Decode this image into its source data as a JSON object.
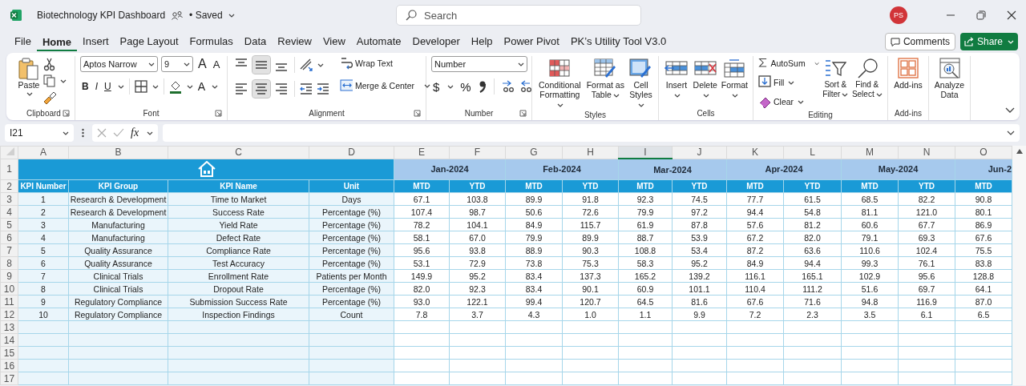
{
  "title_bar": {
    "file_name": "Biotechnology KPI Dashboard",
    "save_status": "• Saved",
    "search_placeholder": "Search",
    "avatar_initials": "PS"
  },
  "menu_tabs": [
    {
      "label": "File",
      "selected": false
    },
    {
      "label": "Home",
      "selected": true
    },
    {
      "label": "Insert",
      "selected": false
    },
    {
      "label": "Page Layout",
      "selected": false
    },
    {
      "label": "Formulas",
      "selected": false
    },
    {
      "label": "Data",
      "selected": false
    },
    {
      "label": "Review",
      "selected": false
    },
    {
      "label": "View",
      "selected": false
    },
    {
      "label": "Automate",
      "selected": false
    },
    {
      "label": "Developer",
      "selected": false
    },
    {
      "label": "Help",
      "selected": false
    },
    {
      "label": "Power Pivot",
      "selected": false
    },
    {
      "label": "PK’s Utility Tool V3.0",
      "selected": false
    }
  ],
  "header_buttons": {
    "comments": "Comments",
    "share": "Share"
  },
  "ribbon": {
    "clipboard": {
      "label": "Clipboard",
      "paste": "Paste"
    },
    "font": {
      "label": "Font",
      "font_name": "Aptos Narrow",
      "font_size": "9",
      "grow_font": "A",
      "shrink_font": "A",
      "bold": "B",
      "italic": "I",
      "underline": "U",
      "font_color": "A"
    },
    "alignment": {
      "label": "Alignment",
      "wrap_text": "Wrap Text",
      "merge_center": "Merge & Center",
      "vertical_buttons": [
        {
          "selected": false
        },
        {
          "selected": true
        },
        {
          "selected": false
        }
      ],
      "horizontal_buttons": [
        {
          "selected": false
        },
        {
          "selected": true
        },
        {
          "selected": false
        }
      ]
    },
    "number": {
      "label": "Number",
      "format": "Number",
      "currency": "$",
      "percent": "%"
    },
    "styles": {
      "label": "Styles",
      "conditional_formatting": "Conditional Formatting",
      "format_as_table": "Format as Table",
      "cell_styles": "Cell Styles"
    },
    "cells": {
      "label": "Cells",
      "insert": "Insert",
      "delete": "Delete",
      "format": "Format"
    },
    "editing": {
      "label": "Editing",
      "autosum": "AutoSum",
      "fill": "Fill",
      "clear": "Clear",
      "sort_filter": "Sort & Filter",
      "find_select": "Find & Select"
    },
    "add_ins": {
      "label": "Add-ins",
      "add_ins": "Add-ins"
    },
    "analysis": {
      "analyze_data": "Analyze Data"
    }
  },
  "formula_bar": {
    "name_box": "I21",
    "function_label": "fx"
  },
  "sheet": {
    "column_letters": [
      {
        "letter": "A",
        "selected": false
      },
      {
        "letter": "B",
        "selected": false
      },
      {
        "letter": "C",
        "selected": false
      },
      {
        "letter": "D",
        "selected": false
      },
      {
        "letter": "E",
        "selected": false
      },
      {
        "letter": "F",
        "selected": false
      },
      {
        "letter": "G",
        "selected": false
      },
      {
        "letter": "H",
        "selected": false
      },
      {
        "letter": "I",
        "selected": true
      },
      {
        "letter": "J",
        "selected": false
      },
      {
        "letter": "K",
        "selected": false
      },
      {
        "letter": "L",
        "selected": false
      },
      {
        "letter": "M",
        "selected": false
      },
      {
        "letter": "N",
        "selected": false
      },
      {
        "letter": "O",
        "selected": false
      }
    ],
    "row_numbers": [
      "1",
      "2",
      "3",
      "4",
      "5",
      "6",
      "7",
      "8",
      "9",
      "10",
      "11",
      "12",
      "13",
      "14",
      "15",
      "16",
      "17"
    ],
    "header_labels": [
      "KPI Number",
      "KPI Group",
      "KPI Name",
      "Unit"
    ],
    "months": [
      "Jan-2024",
      "Feb-2024",
      "Mar-2024",
      "Apr-2024",
      "May-2024",
      "Jun-2"
    ],
    "sub_headers": [
      "MTD",
      "YTD",
      "MTD",
      "YTD",
      "MTD",
      "YTD",
      "MTD",
      "YTD",
      "MTD",
      "YTD",
      "MTD"
    ],
    "rows": [
      {
        "number": "1",
        "group": "Research & Development",
        "name": "Time to Market",
        "unit": "Days",
        "values": [
          "67.1",
          "103.8",
          "89.9",
          "91.8",
          "92.3",
          "74.5",
          "77.7",
          "61.5",
          "68.5",
          "82.2",
          "90.8"
        ]
      },
      {
        "number": "2",
        "group": "Research & Development",
        "name": "Success Rate",
        "unit": "Percentage (%)",
        "values": [
          "107.4",
          "98.7",
          "50.6",
          "72.6",
          "79.9",
          "97.2",
          "94.4",
          "54.8",
          "81.1",
          "121.0",
          "80.1"
        ]
      },
      {
        "number": "3",
        "group": "Manufacturing",
        "name": "Yield Rate",
        "unit": "Percentage (%)",
        "values": [
          "78.2",
          "104.1",
          "84.9",
          "115.7",
          "61.9",
          "87.8",
          "57.6",
          "81.2",
          "60.6",
          "67.7",
          "86.9"
        ]
      },
      {
        "number": "4",
        "group": "Manufacturing",
        "name": "Defect Rate",
        "unit": "Percentage (%)",
        "values": [
          "58.1",
          "67.0",
          "79.9",
          "89.9",
          "88.7",
          "53.9",
          "67.2",
          "82.0",
          "79.1",
          "69.3",
          "67.6"
        ]
      },
      {
        "number": "5",
        "group": "Quality Assurance",
        "name": "Compliance Rate",
        "unit": "Percentage (%)",
        "values": [
          "95.6",
          "93.8",
          "88.9",
          "90.3",
          "108.8",
          "53.4",
          "87.2",
          "63.6",
          "110.6",
          "102.4",
          "75.5"
        ]
      },
      {
        "number": "6",
        "group": "Quality Assurance",
        "name": "Test Accuracy",
        "unit": "Percentage (%)",
        "values": [
          "53.1",
          "72.9",
          "73.8",
          "75.3",
          "58.3",
          "95.2",
          "84.9",
          "94.4",
          "99.3",
          "76.1",
          "83.8"
        ]
      },
      {
        "number": "7",
        "group": "Clinical Trials",
        "name": "Enrollment Rate",
        "unit": "Patients per Month",
        "values": [
          "149.9",
          "95.2",
          "83.4",
          "137.3",
          "165.2",
          "139.2",
          "116.1",
          "165.1",
          "102.9",
          "95.6",
          "128.8"
        ]
      },
      {
        "number": "8",
        "group": "Clinical Trials",
        "name": "Dropout Rate",
        "unit": "Percentage (%)",
        "values": [
          "82.0",
          "92.3",
          "83.4",
          "90.1",
          "60.9",
          "101.1",
          "110.4",
          "111.2",
          "51.6",
          "69.7",
          "64.1"
        ]
      },
      {
        "number": "9",
        "group": "Regulatory Compliance",
        "name": "Submission Success Rate",
        "unit": "Percentage (%)",
        "values": [
          "93.0",
          "122.1",
          "99.4",
          "120.7",
          "64.5",
          "81.6",
          "67.6",
          "71.6",
          "94.8",
          "116.9",
          "87.0"
        ]
      },
      {
        "number": "10",
        "group": "Regulatory Compliance",
        "name": "Inspection Findings",
        "unit": "Count",
        "values": [
          "7.8",
          "3.7",
          "4.3",
          "1.0",
          "1.1",
          "9.9",
          "7.2",
          "2.3",
          "3.5",
          "6.1",
          "6.5"
        ]
      }
    ]
  }
}
